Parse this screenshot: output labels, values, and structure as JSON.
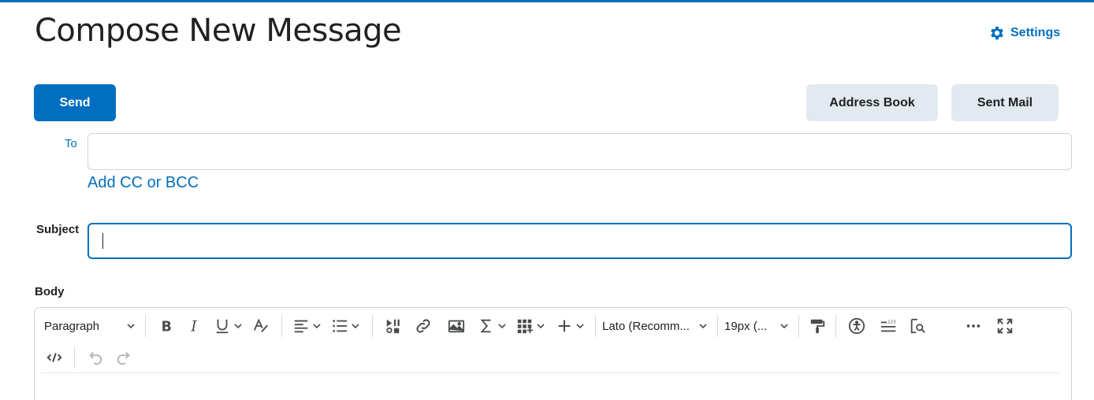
{
  "page": {
    "title": "Compose New Message",
    "settings_label": "Settings"
  },
  "actions": {
    "send_label": "Send",
    "address_book_label": "Address Book",
    "sent_mail_label": "Sent Mail"
  },
  "form": {
    "to_label": "To",
    "to_value": "",
    "add_cc_bcc_label": "Add CC or BCC",
    "subject_label": "Subject",
    "subject_value": "",
    "body_label": "Body"
  },
  "editor": {
    "block_format": "Paragraph",
    "font_family": "Lato (Recomm...",
    "font_size": "19px (..."
  },
  "colors": {
    "accent": "#006fbf",
    "secondary_button": "#e3e9f1"
  }
}
